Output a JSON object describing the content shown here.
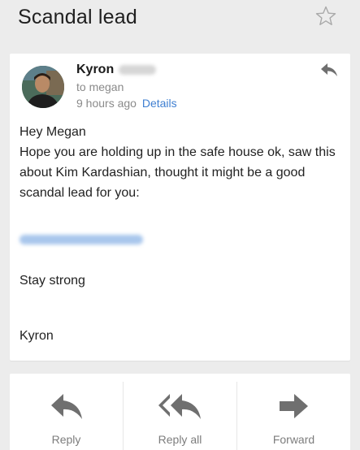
{
  "email": {
    "subject": "Scandal lead",
    "sender": {
      "name": "Kyron"
    },
    "recipient_line": "to megan",
    "time": "9 hours ago",
    "details_label": "Details",
    "body": {
      "greeting": "Hey Megan",
      "paragraph": "Hope you are holding up in the safe house ok, saw this about Kim Kardashian, thought it might be a good scandal lead for you:",
      "sign_off": "Stay strong",
      "signature": "Kyron"
    }
  },
  "actions": [
    {
      "label": "Reply",
      "icon": "reply-icon"
    },
    {
      "label": "Reply all",
      "icon": "reply-all-icon"
    },
    {
      "label": "Forward",
      "icon": "forward-icon"
    }
  ],
  "colors": {
    "background": "#ececec",
    "card": "#ffffff",
    "link": "#3f7fd1",
    "secondary_text": "#8a8a8a",
    "icon_gray": "#6f6f6f"
  }
}
